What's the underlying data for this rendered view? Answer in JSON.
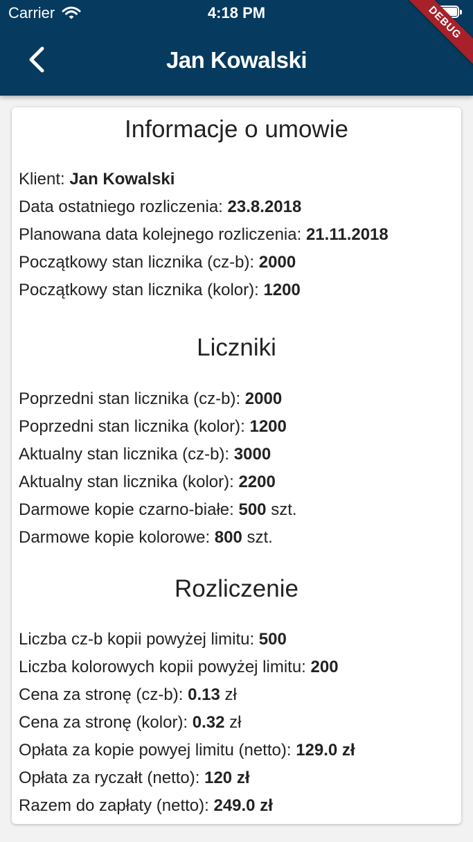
{
  "status_bar": {
    "carrier": "Carrier",
    "time": "4:18 PM"
  },
  "app_bar": {
    "title": "Jan Kowalski",
    "debug_banner": "DEBUG",
    "background_color": "#063a5e"
  },
  "sections": {
    "contract": {
      "title": "Informacje o umowie",
      "rows": [
        {
          "label": "Klient:",
          "value": "Jan Kowalski",
          "unit": ""
        },
        {
          "label": "Data ostatniego rozliczenia:",
          "value": "23.8.2018",
          "unit": ""
        },
        {
          "label": "Planowana data kolejnego rozliczenia:",
          "value": "21.11.2018",
          "unit": ""
        },
        {
          "label": "Początkowy stan licznika (cz-b):",
          "value": "2000",
          "unit": ""
        },
        {
          "label": "Początkowy stan licznika (kolor):",
          "value": "1200",
          "unit": ""
        }
      ]
    },
    "counters": {
      "title": "Liczniki",
      "rows": [
        {
          "label": "Poprzedni stan licznika (cz-b):",
          "value": "2000",
          "unit": ""
        },
        {
          "label": "Poprzedni stan licznika (kolor):",
          "value": "1200",
          "unit": ""
        },
        {
          "label": "Aktualny stan licznika (cz-b):",
          "value": "3000",
          "unit": ""
        },
        {
          "label": "Aktualny stan licznika (kolor):",
          "value": "2200",
          "unit": ""
        },
        {
          "label": "Darmowe kopie czarno-białe:",
          "value": "500",
          "unit": "szt."
        },
        {
          "label": "Darmowe kopie kolorowe:",
          "value": "800",
          "unit": "szt."
        }
      ]
    },
    "billing": {
      "title": "Rozliczenie",
      "rows": [
        {
          "label": "Liczba cz-b kopii powyżej limitu:",
          "value": "500",
          "unit": ""
        },
        {
          "label": "Liczba kolorowych kopii powyżej limitu:",
          "value": "200",
          "unit": ""
        },
        {
          "label": "Cena za stronę (cz-b):",
          "value": "0.13",
          "unit": "zł"
        },
        {
          "label": "Cena za stronę (kolor):",
          "value": "0.32",
          "unit": "zł"
        },
        {
          "label": "Opłata za kopie powyej limitu (netto):",
          "value": "129.0 zł",
          "unit": ""
        },
        {
          "label": "Opłata za ryczałt (netto):",
          "value": "120 zł",
          "unit": ""
        },
        {
          "label": "Razem do zapłaty (netto):",
          "value": "249.0 zł",
          "unit": ""
        }
      ]
    }
  }
}
